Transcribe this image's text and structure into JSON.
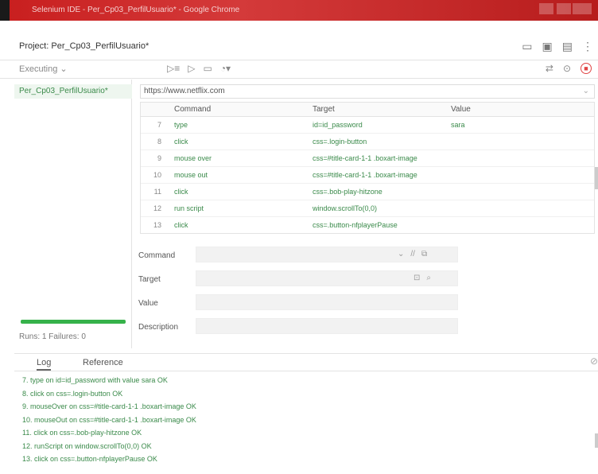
{
  "window": {
    "title": "Selenium IDE - Per_Cp03_PerfilUsuario* - Google Chrome"
  },
  "project": {
    "label": "Project:",
    "name": "Per_Cp03_PerfilUsuario*"
  },
  "toolbar": {
    "executing": "Executing",
    "executing_caret": "⌄"
  },
  "sidebar": {
    "tests": [
      {
        "label": "Per_Cp03_PerfilUsuario*"
      }
    ],
    "status": "Runs: 1   Failures: 0",
    "progress": 1.0
  },
  "url": {
    "value": "https://www.netflix.com"
  },
  "table": {
    "headers": {
      "command": "Command",
      "target": "Target",
      "value": "Value"
    },
    "rows": [
      {
        "n": "7",
        "command": "type",
        "target": "id=id_password",
        "value": "sara"
      },
      {
        "n": "8",
        "command": "click",
        "target": "css=.login-button",
        "value": ""
      },
      {
        "n": "9",
        "command": "mouse over",
        "target": "css=#title-card-1-1 .boxart-image",
        "value": ""
      },
      {
        "n": "10",
        "command": "mouse out",
        "target": "css=#title-card-1-1 .boxart-image",
        "value": ""
      },
      {
        "n": "11",
        "command": "click",
        "target": "css=.bob-play-hitzone",
        "value": ""
      },
      {
        "n": "12",
        "command": "run script",
        "target": "window.scrollTo(0,0)",
        "value": ""
      },
      {
        "n": "13",
        "command": "click",
        "target": "css=.button-nfplayerPause",
        "value": ""
      }
    ]
  },
  "form": {
    "command_label": "Command",
    "target_label": "Target",
    "value_label": "Value",
    "description_label": "Description"
  },
  "bottom": {
    "tabs": {
      "log": "Log",
      "reference": "Reference"
    },
    "log": [
      "7.  type on id=id_password with value sara OK",
      "8.  click on css=.login-button OK",
      "9.  mouseOver on css=#title-card-1-1 .boxart-image OK",
      "10.  mouseOut on css=#title-card-1-1 .boxart-image OK",
      "11.  click on css=.bob-play-hitzone OK",
      "12.  runScript on window.scrollTo(0,0) OK",
      "13.  click on css=.button-nfplayerPause OK"
    ]
  },
  "colors": {
    "accent_green": "#3a8a4a",
    "titlebar_red": "#c81e1e",
    "stop_red": "#e04444"
  }
}
